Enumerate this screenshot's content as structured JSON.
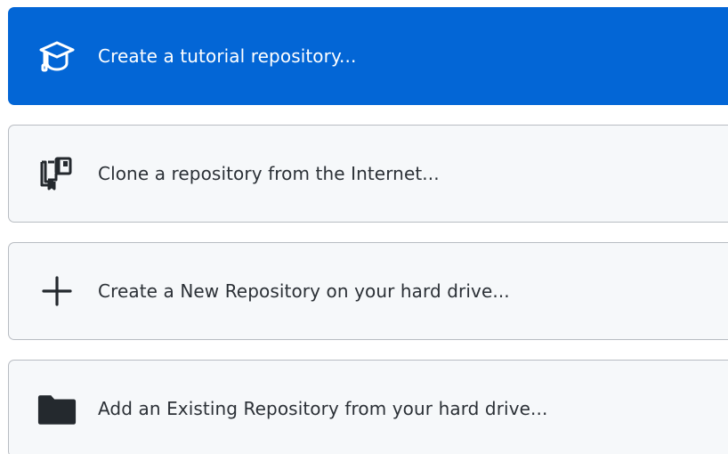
{
  "options": [
    {
      "label": "Create a tutorial repository...",
      "icon": "mortarboard-icon",
      "selected": true
    },
    {
      "label": "Clone a repository from the Internet...",
      "icon": "repo-clone-icon",
      "selected": false
    },
    {
      "label": "Create a New Repository on your hard drive...",
      "icon": "plus-icon",
      "selected": false
    },
    {
      "label": "Add an Existing Repository from your hard drive...",
      "icon": "folder-icon",
      "selected": false
    }
  ],
  "colors": {
    "accent": "#0366d6",
    "card_background": "#f6f8fa",
    "card_border": "#b8bcc2",
    "text": "#2b3036",
    "icon": "#24292e"
  }
}
